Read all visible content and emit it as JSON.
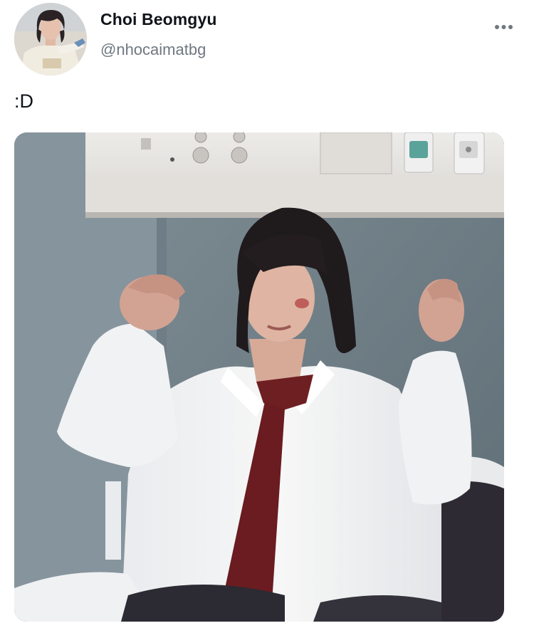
{
  "author": {
    "display_name": "Choi Beomgyu",
    "handle": "@nhocaimatbg",
    "avatar_icon": "profile-photo-avatar"
  },
  "more_icon": "more-horizontal-icon",
  "tweet": {
    "text": ":D"
  },
  "media": {
    "icon": "attached-photo",
    "colors": {
      "wall_left": "#7f8f99",
      "wall_right": "#697880",
      "panel": "#e9e6e2",
      "shirt": "#f4f4f4",
      "tie": "#6e1f22",
      "hair": "#1f1a1c",
      "skin": "#d6a896"
    }
  },
  "colors": {
    "text_primary": "#0f1419",
    "text_secondary": "#6e7881",
    "background": "#ffffff"
  }
}
